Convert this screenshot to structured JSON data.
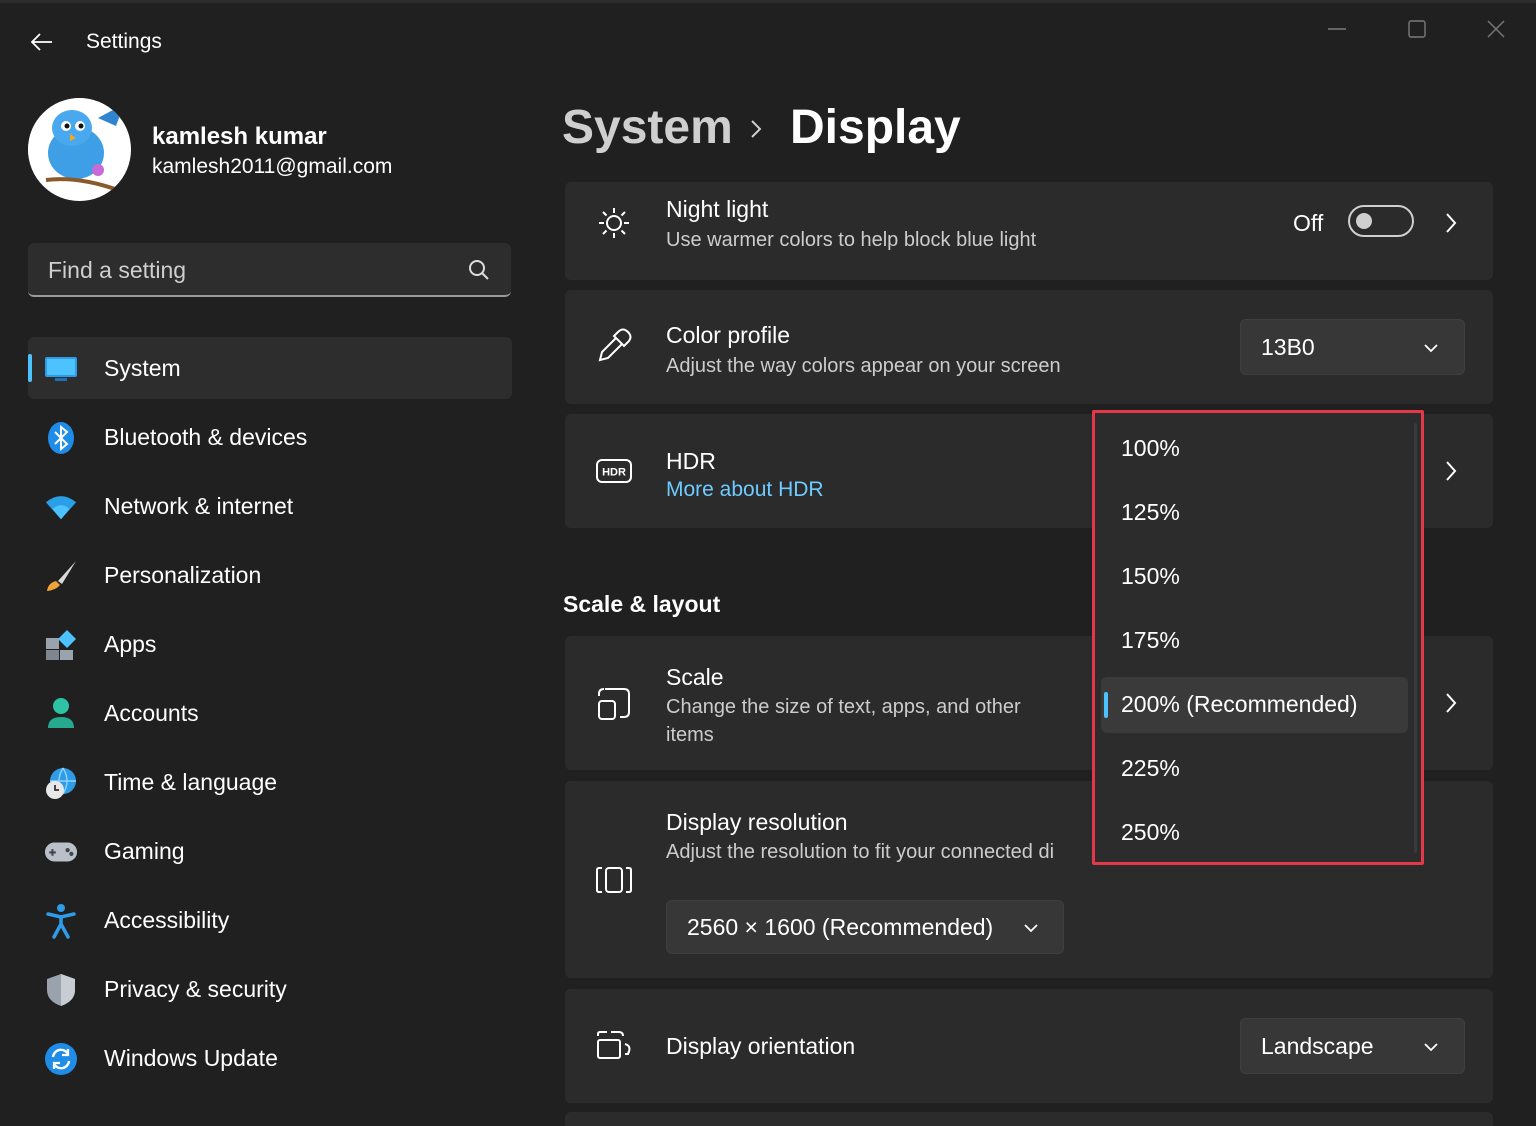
{
  "window": {
    "title": "Settings"
  },
  "user": {
    "name": "kamlesh kumar",
    "email": "kamlesh2011@gmail.com"
  },
  "search": {
    "placeholder": "Find a setting"
  },
  "nav": {
    "items": [
      {
        "label": "System",
        "icon": "monitor-icon",
        "selected": true
      },
      {
        "label": "Bluetooth & devices",
        "icon": "bluetooth-icon"
      },
      {
        "label": "Network & internet",
        "icon": "wifi-icon"
      },
      {
        "label": "Personalization",
        "icon": "paintbrush-icon"
      },
      {
        "label": "Apps",
        "icon": "apps-icon"
      },
      {
        "label": "Accounts",
        "icon": "person-icon"
      },
      {
        "label": "Time & language",
        "icon": "globe-clock-icon"
      },
      {
        "label": "Gaming",
        "icon": "gamepad-icon"
      },
      {
        "label": "Accessibility",
        "icon": "accessibility-icon"
      },
      {
        "label": "Privacy & security",
        "icon": "shield-icon"
      },
      {
        "label": "Windows Update",
        "icon": "update-icon"
      }
    ]
  },
  "breadcrumb": {
    "parent": "System",
    "current": "Display"
  },
  "night_light": {
    "title": "Night light",
    "subtitle": "Use warmer colors to help block blue light",
    "toggle_label": "Off",
    "toggle_on": false
  },
  "color_profile": {
    "title": "Color profile",
    "subtitle": "Adjust the way colors appear on your screen",
    "value": "13B0"
  },
  "hdr": {
    "title": "HDR",
    "link": "More about HDR"
  },
  "scale_layout": {
    "title": "Scale & layout"
  },
  "scale": {
    "title": "Scale",
    "subtitle_line1": "Change the size of text, apps, and other",
    "subtitle_line2": "items"
  },
  "resolution": {
    "title": "Display resolution",
    "subtitle": "Adjust the resolution to fit your connected di",
    "value": "2560 × 1600 (Recommended)"
  },
  "orientation": {
    "title": "Display orientation",
    "value": "Landscape"
  },
  "scale_menu": {
    "options": [
      "100%",
      "125%",
      "150%",
      "175%",
      "200% (Recommended)",
      "225%",
      "250%"
    ],
    "selected": "200% (Recommended)"
  },
  "colors": {
    "accent": "#4cc2ff",
    "highlight_border": "#e5374a",
    "background": "#202020",
    "card": "#2b2b2b"
  }
}
